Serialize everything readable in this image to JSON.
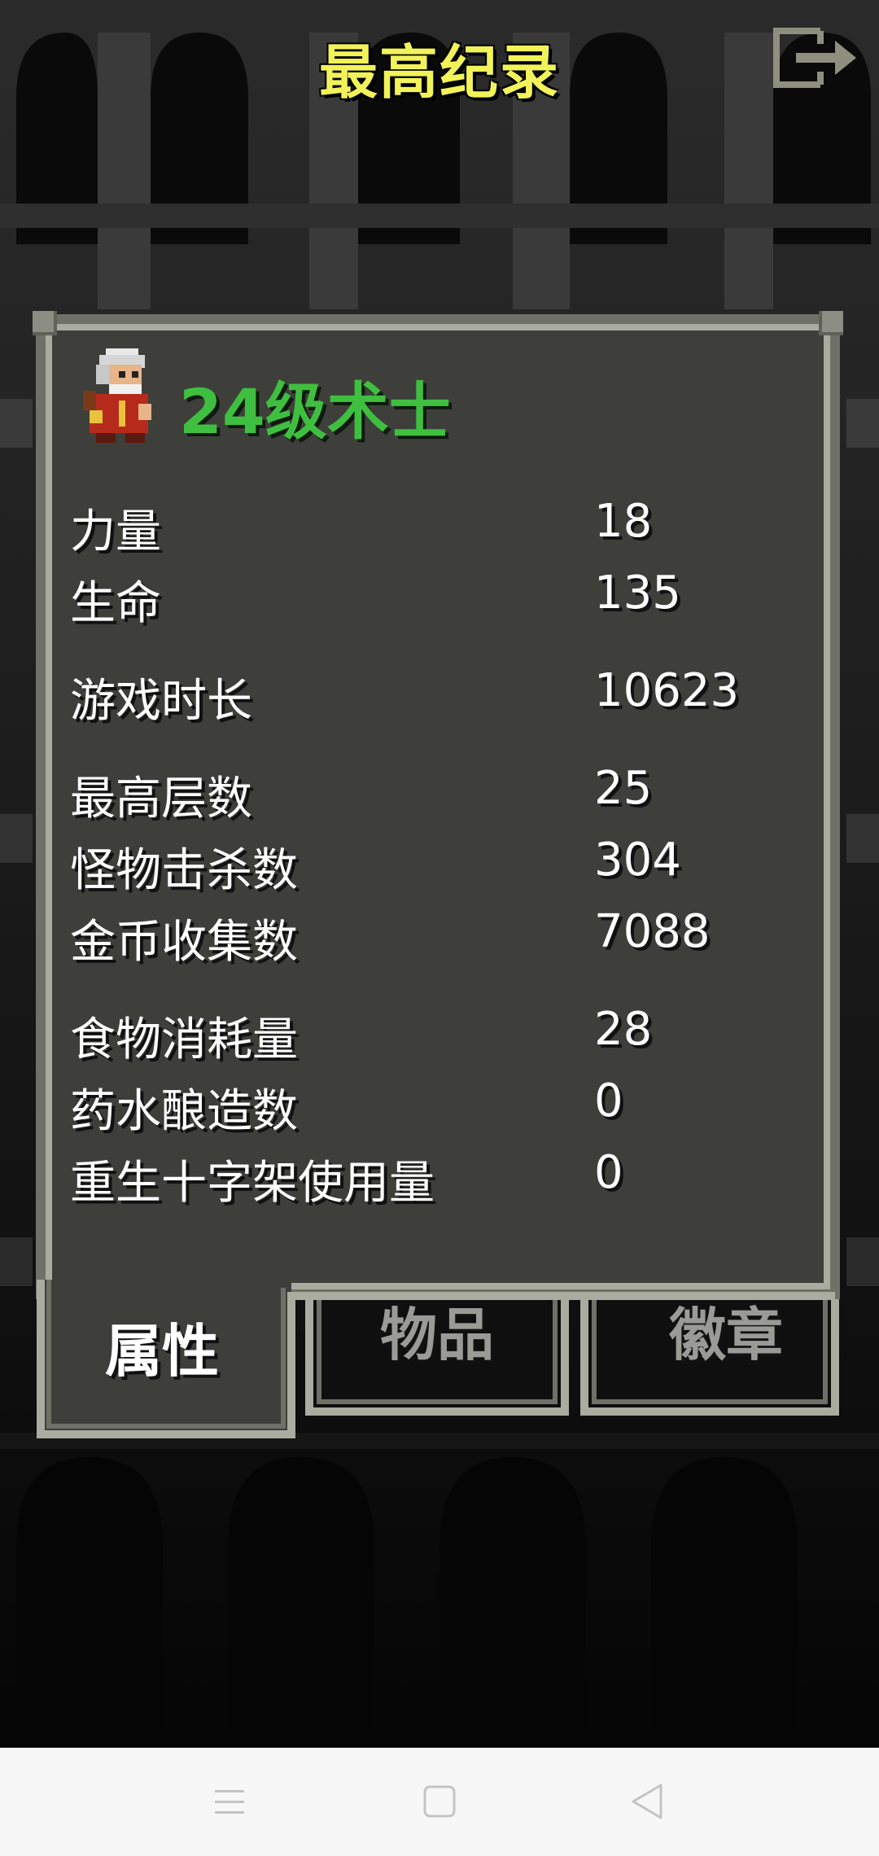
{
  "header": {
    "title": "最高纪录",
    "exit_icon": "exit-door-arrow-icon"
  },
  "hero": {
    "avatar_icon": "warlock-sprite-icon",
    "title": "24级术士",
    "title_color": "#3fbf3f"
  },
  "stats": [
    {
      "label": "力量",
      "value": "18"
    },
    {
      "label": "生命",
      "value": "135"
    },
    {
      "label": "游戏时长",
      "value": "10623"
    },
    {
      "label": "最高层数",
      "value": "25"
    },
    {
      "label": "怪物击杀数",
      "value": "304"
    },
    {
      "label": "金币收集数",
      "value": "7088"
    },
    {
      "label": "食物消耗量",
      "value": "28"
    },
    {
      "label": "药水酿造数",
      "value": "0"
    },
    {
      "label": "重生十字架使用量",
      "value": "0"
    }
  ],
  "tabs": [
    {
      "label": "属性",
      "active": true
    },
    {
      "label": "物品",
      "active": false
    },
    {
      "label": "徽章",
      "active": false
    }
  ],
  "nav": {
    "menu_icon": "menu-lines-icon",
    "home_icon": "home-square-icon",
    "back_icon": "back-triangle-icon"
  },
  "colors": {
    "title": "#f2f25a",
    "panel_fill": "#3e3f3b",
    "panel_border": "#9c9f92",
    "inactive_tab_text": "#9a9a96"
  }
}
